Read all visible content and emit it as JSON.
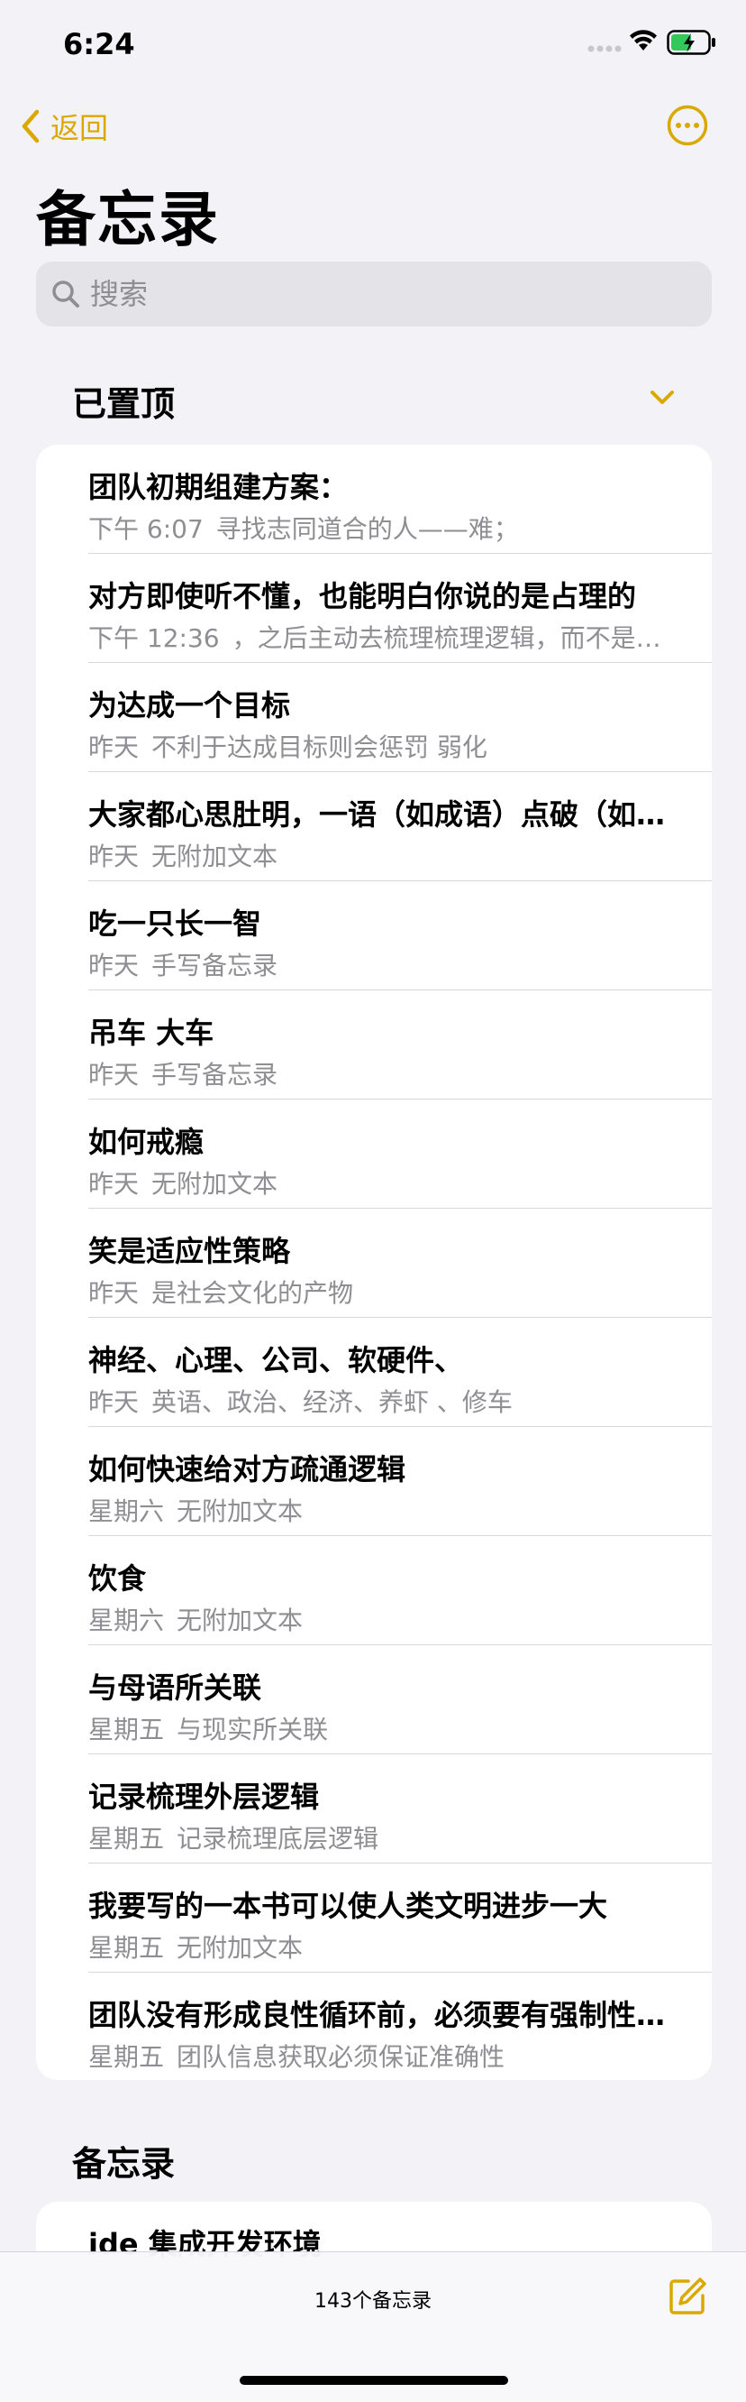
{
  "status": {
    "time": "6:24"
  },
  "nav": {
    "back_label": "返回"
  },
  "title": "备忘录",
  "search": {
    "placeholder": "搜索"
  },
  "pinned": {
    "header": "已置顶",
    "notes": [
      {
        "title": "团队初期组建方案：",
        "date": "下午 6:07",
        "preview": "寻找志同道合的人——难；"
      },
      {
        "title": "对方即使听不懂，也能明白你说的是占理的",
        "date": "下午 12:36",
        "preview": "，之后主动去梳理梳理逻辑，而不是直接下结论"
      },
      {
        "title": "为达成一个目标",
        "date": "昨天",
        "preview": "不利于达成目标则会惩罚 弱化"
      },
      {
        "title": "大家都心思肚明，一语（如成语）点破（如成语）",
        "date": "昨天",
        "preview": "无附加文本"
      },
      {
        "title": "吃一只长一智",
        "date": "昨天",
        "preview": "手写备忘录"
      },
      {
        "title": "吊车 大车",
        "date": "昨天",
        "preview": "手写备忘录"
      },
      {
        "title": "如何戒瘾",
        "date": "昨天",
        "preview": "无附加文本"
      },
      {
        "title": "笑是适应性策略",
        "date": "昨天",
        "preview": "是社会文化的产物"
      },
      {
        "title": "神经、心理、公司、软硬件、",
        "date": "昨天",
        "preview": "英语、政治、经济、养虾 、修车"
      },
      {
        "title": "如何快速给对方疏通逻辑",
        "date": "星期六",
        "preview": "无附加文本"
      },
      {
        "title": "饮食",
        "date": "星期六",
        "preview": "无附加文本"
      },
      {
        "title": "与母语所关联",
        "date": "星期五",
        "preview": "与现实所关联"
      },
      {
        "title": "记录梳理外层逻辑",
        "date": "星期五",
        "preview": "记录梳理底层逻辑"
      },
      {
        "title": "我要写的一本书可以使人类文明进步一大",
        "date": "星期五",
        "preview": "无附加文本"
      },
      {
        "title": "团队没有形成良性循环前，必须要有强制性规定",
        "date": "星期五",
        "preview": "团队信息获取必须保证准确性"
      }
    ]
  },
  "notes_section": {
    "header": "备忘录",
    "notes": [
      {
        "title": "ide 集成开发环境"
      }
    ]
  },
  "toolbar": {
    "count_label": "143个备忘录"
  },
  "colors": {
    "accent": "#dba800",
    "background": "#f2f2f7",
    "secondary_text": "#8e8e93"
  },
  "icons": {
    "back": "chevron-left-icon",
    "more": "ellipsis-circle-icon",
    "search": "magnifier-icon",
    "collapse": "chevron-down-icon",
    "compose": "compose-icon"
  }
}
